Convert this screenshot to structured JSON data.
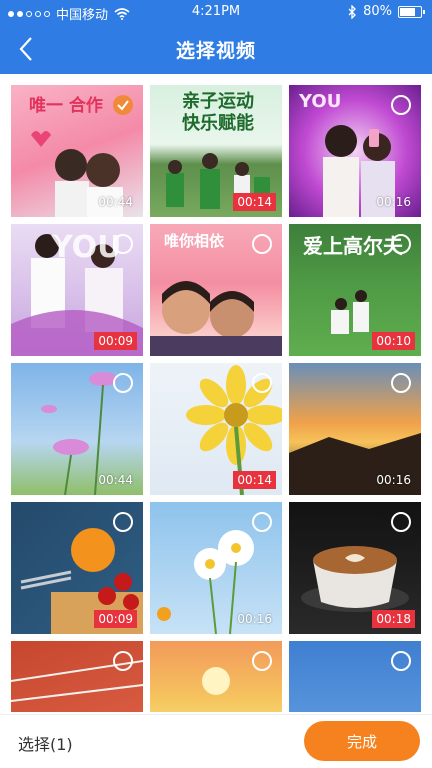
{
  "status_bar": {
    "carrier": "中国移动",
    "time": "4:21PM",
    "battery": "80%",
    "battery_level": 0.8,
    "icons": [
      "wifi-icon",
      "bluetooth-icon",
      "battery-icon"
    ]
  },
  "header": {
    "title": "选择视频",
    "back_icon": "chevron-left-icon",
    "color": "#2f7de4"
  },
  "grid": {
    "items": [
      {
        "duration": "00:44",
        "selected": true,
        "overlay": "唯一 合作"
      },
      {
        "duration": "00:14",
        "selected": false,
        "overlay": "亲子运动 快乐赋能"
      },
      {
        "duration": "00:16",
        "selected": false,
        "overlay": "YOU"
      },
      {
        "duration": "00:09",
        "selected": false,
        "overlay": "YOU"
      },
      {
        "duration": "",
        "selected": false,
        "overlay": "唯你相依"
      },
      {
        "duration": "00:10",
        "selected": false,
        "overlay": "爱上高尔夫"
      },
      {
        "duration": "00:44",
        "selected": false,
        "overlay": ""
      },
      {
        "duration": "00:14",
        "selected": false,
        "overlay": ""
      },
      {
        "duration": "00:16",
        "selected": false,
        "overlay": ""
      },
      {
        "duration": "00:09",
        "selected": false,
        "overlay": ""
      },
      {
        "duration": "00:16",
        "selected": false,
        "overlay": ""
      },
      {
        "duration": "00:18",
        "selected": false,
        "overlay": ""
      },
      {
        "duration": "",
        "selected": false,
        "overlay": ""
      },
      {
        "duration": "",
        "selected": false,
        "overlay": ""
      },
      {
        "duration": "",
        "selected": false,
        "overlay": ""
      }
    ]
  },
  "bottom": {
    "selected_label": "选择(1)",
    "done_label": "完成",
    "accent": "#f6821f"
  }
}
